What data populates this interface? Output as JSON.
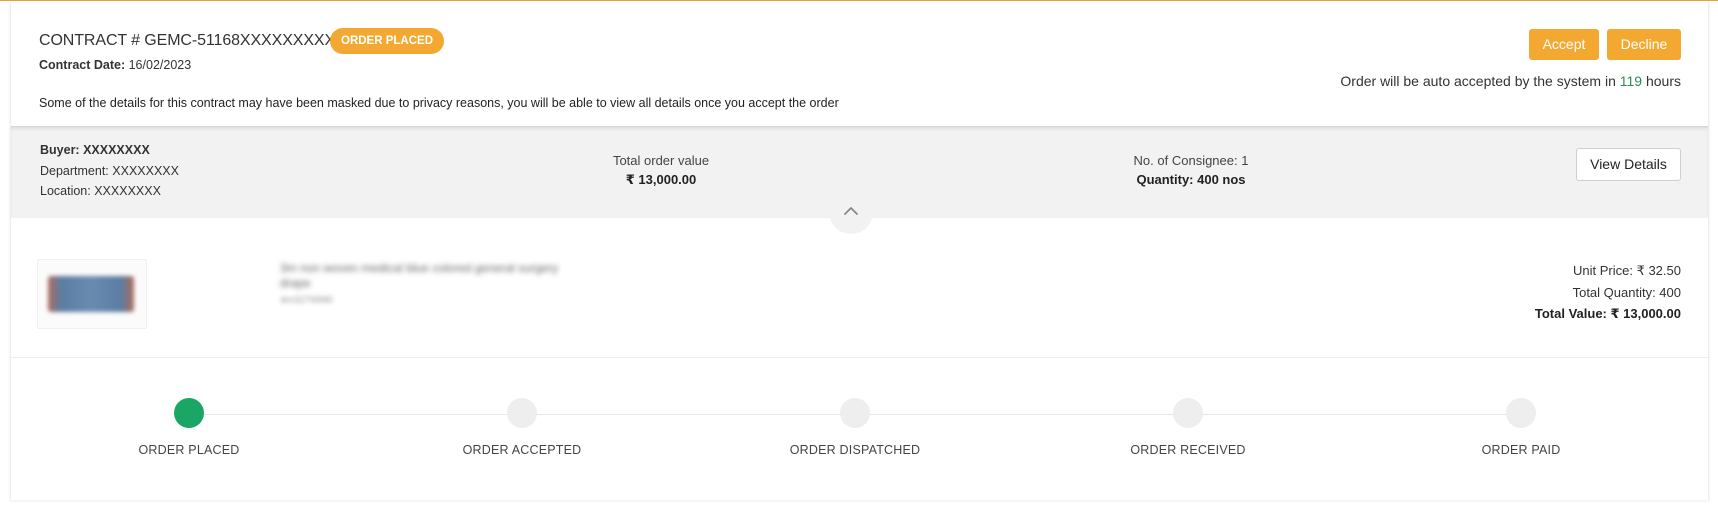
{
  "contract": {
    "title": "CONTRACT # GEMC-51168XXXXXXXXXX",
    "status_badge": "ORDER PLACED",
    "date_label": "Contract Date:",
    "date_value": "16/02/2023",
    "privacy_note": "Some of the details for this contract may have been masked due to privacy reasons, you will be able to view all details once you accept the order"
  },
  "actions": {
    "accept_label": "Accept",
    "decline_label": "Decline",
    "auto_accept_prefix": "Order will be auto accepted by the system in",
    "auto_accept_hours": "119",
    "auto_accept_suffix": "hours"
  },
  "summary": {
    "buyer_label": "Buyer:",
    "buyer_value": "XXXXXXXX",
    "department_label": "Department:",
    "department_value": "XXXXXXXX",
    "location_label": "Location:",
    "location_value": "XXXXXXXX",
    "total_label": "Total order value",
    "total_value": "₹ 13,000.00",
    "consignee_label": "No. of Consignee: 1",
    "quantity_label": "Quantity: 400 nos",
    "view_details_label": "View Details"
  },
  "product": {
    "name": "3m non woven medical blue colored general surgery drape",
    "code": "4m3276990",
    "unit_price": "Unit Price: ₹ 32.50",
    "total_quantity": "Total Quantity: 400",
    "total_value": "Total Value: ₹ 13,000.00"
  },
  "tracker": {
    "steps": [
      {
        "label": "ORDER PLACED",
        "done": true
      },
      {
        "label": "ORDER ACCEPTED",
        "done": false
      },
      {
        "label": "ORDER DISPATCHED",
        "done": false
      },
      {
        "label": "ORDER RECEIVED",
        "done": false
      },
      {
        "label": "ORDER PAID",
        "done": false
      }
    ]
  },
  "colors": {
    "accent": "#f3a832",
    "success": "#1aa765",
    "pending": "#eeeeee"
  },
  "icons": {
    "collapse": "chevron-up-icon"
  }
}
